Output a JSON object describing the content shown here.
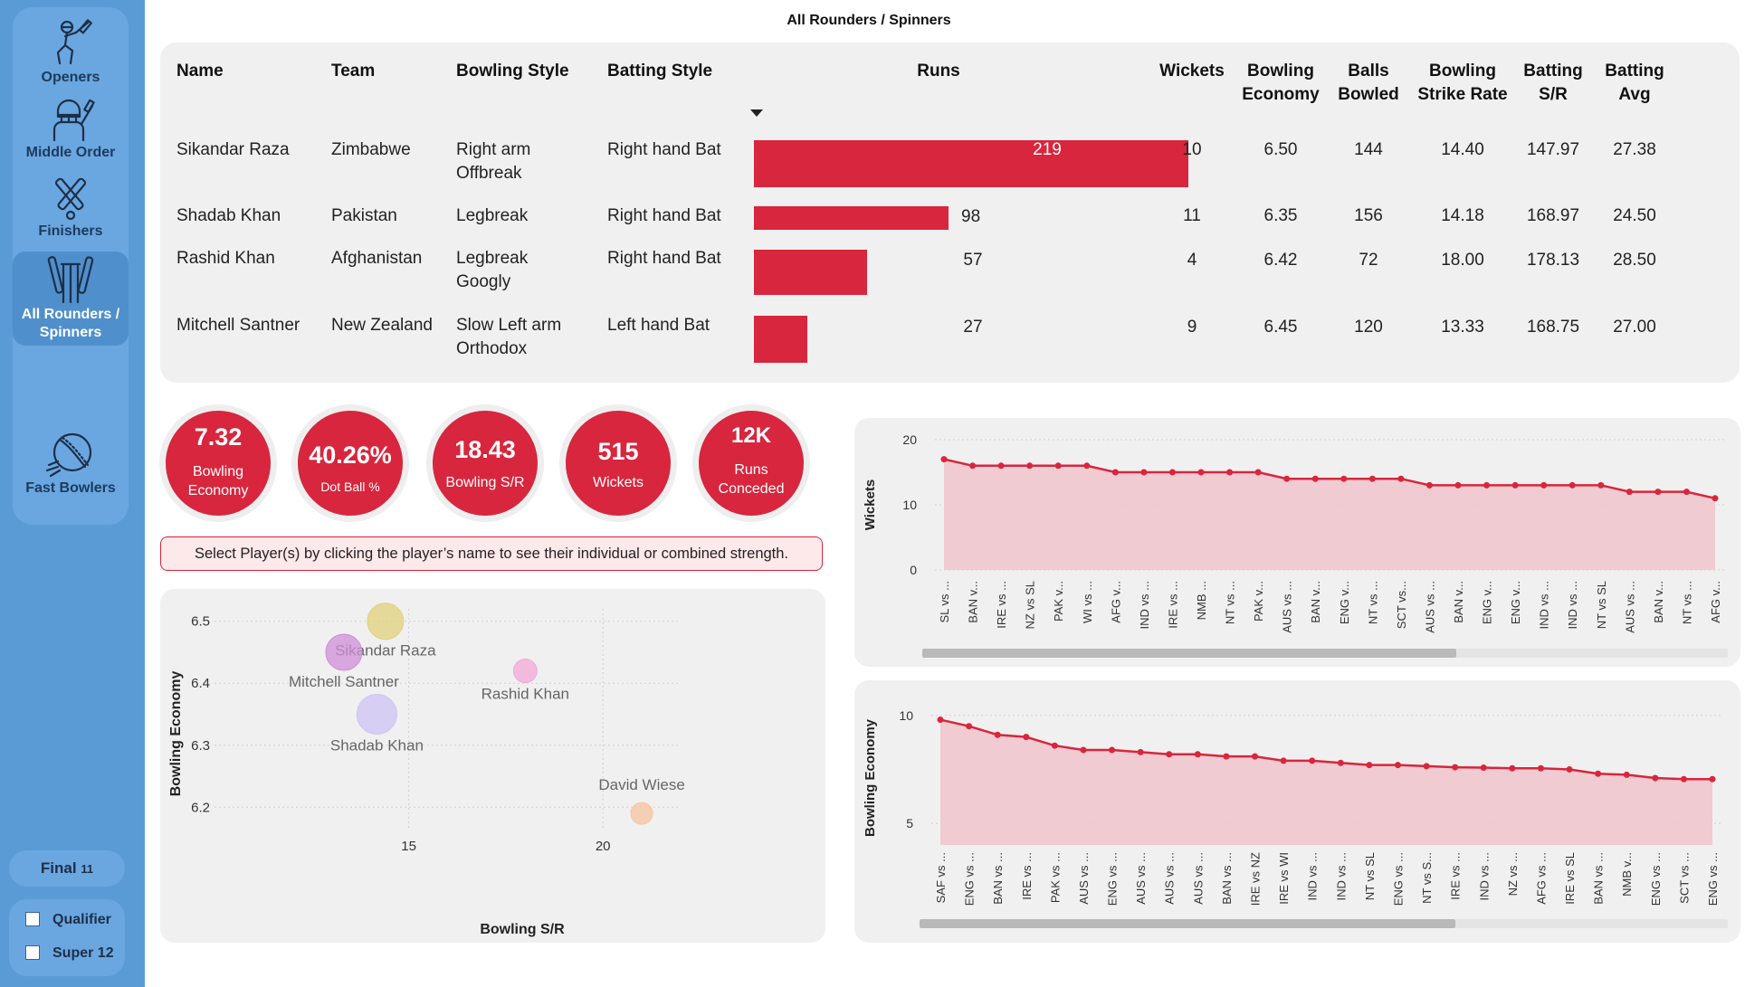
{
  "sidebar": {
    "items": [
      {
        "label": "Openers",
        "icon": "batsman-icon"
      },
      {
        "label": "Middle Order",
        "icon": "batsman-helmet-icon"
      },
      {
        "label": "Finishers",
        "icon": "crossed-bats-icon"
      },
      {
        "label": "All Rounders / Spinners",
        "icon": "stumps-bats-icon"
      },
      {
        "label": "Fast Bowlers",
        "icon": "cricket-ball-icon"
      }
    ],
    "final": {
      "label": "Final",
      "count": "11"
    },
    "filters": [
      {
        "label": "Qualifier",
        "checked": false
      },
      {
        "label": "Super 12",
        "checked": false
      }
    ]
  },
  "page": {
    "title": "All Rounders / Spinners"
  },
  "table": {
    "headers": {
      "name": "Name",
      "team": "Team",
      "bowling_style": "Bowling Style",
      "batting_style": "Batting Style",
      "runs": "Runs",
      "wickets": "Wickets",
      "economy": [
        "Bowling",
        "Economy"
      ],
      "balls": [
        "Balls",
        "Bowled"
      ],
      "strike": [
        "Bowling",
        "Strike Rate"
      ],
      "bat_sr": [
        "Batting",
        "S/R"
      ],
      "bat_avg": [
        "Batting",
        "Avg"
      ]
    },
    "runs_max": 219,
    "rows": [
      {
        "name": "Sikandar Raza",
        "team": "Zimbabwe",
        "bowling_style": [
          "Right arm",
          "Offbreak"
        ],
        "batting_style": "Right hand Bat",
        "runs": 219,
        "wickets": "10",
        "economy": "6.50",
        "balls": "144",
        "strike": "14.40",
        "bat_sr": "147.97",
        "bat_avg": "27.38"
      },
      {
        "name": "Shadab Khan",
        "team": "Pakistan",
        "bowling_style": [
          "Legbreak",
          ""
        ],
        "batting_style": "Right hand Bat",
        "runs": 98,
        "wickets": "11",
        "economy": "6.35",
        "balls": "156",
        "strike": "14.18",
        "bat_sr": "168.97",
        "bat_avg": "24.50"
      },
      {
        "name": "Rashid Khan",
        "team": "Afghanistan",
        "bowling_style": [
          "Legbreak",
          "Googly"
        ],
        "batting_style": "Right hand Bat",
        "runs": 57,
        "wickets": "4",
        "economy": "6.42",
        "balls": "72",
        "strike": "18.00",
        "bat_sr": "178.13",
        "bat_avg": "28.50"
      },
      {
        "name": "Mitchell Santner",
        "team": "New Zealand",
        "bowling_style": [
          "Slow Left arm",
          "Orthodox"
        ],
        "batting_style": "Left hand Bat",
        "runs": 27,
        "wickets": "9",
        "economy": "6.45",
        "balls": "120",
        "strike": "13.33",
        "bat_sr": "168.75",
        "bat_avg": "27.00"
      }
    ]
  },
  "kpis": [
    {
      "value": "7.32",
      "label": [
        "Bowling",
        "Economy"
      ]
    },
    {
      "value": "40.26%",
      "label": [
        "Dot Ball %"
      ]
    },
    {
      "value": "18.43",
      "label": [
        "Bowling S/R"
      ]
    },
    {
      "value": "515",
      "label": [
        "Wickets"
      ]
    },
    {
      "value": "12K",
      "label": [
        "Runs",
        "Conceded"
      ]
    }
  ],
  "banner": "Select Player(s) by clicking the player’s name to see their individual or combined strength.",
  "colors": {
    "accent": "#d7263d",
    "area": "#efc7cd",
    "sidebar": "#5b9bd5"
  },
  "chart_data": [
    {
      "type": "scatter",
      "xlabel": "Bowling S/R",
      "ylabel": "Bowling Economy",
      "xlim": [
        10,
        22
      ],
      "ylim": [
        6.18,
        6.52
      ],
      "xticks": [
        15,
        20
      ],
      "yticks": [
        6.2,
        6.3,
        6.4,
        6.5
      ],
      "grid": true,
      "points": [
        {
          "label": "Sikandar Raza",
          "x": 14.4,
          "y": 6.5,
          "color": "#e0d27c"
        },
        {
          "label": "Mitchell Santner",
          "x": 13.33,
          "y": 6.45,
          "color": "#cf8fd8"
        },
        {
          "label": "Rashid Khan",
          "x": 18.0,
          "y": 6.42,
          "color": "#f3a9d8"
        },
        {
          "label": "Shadab Khan",
          "x": 14.18,
          "y": 6.35,
          "color": "#cfc3f5"
        },
        {
          "label": "David Wiese",
          "x": 21.0,
          "y": 6.19,
          "color": "#f7c4a0"
        }
      ]
    },
    {
      "type": "area",
      "ylabel": "Wickets",
      "ylim": [
        0,
        20
      ],
      "yticks": [
        0,
        10,
        20
      ],
      "grid": true,
      "categories": [
        "SL vs ...",
        "BAN v...",
        "IRE vs ...",
        "NZ vs SL",
        "PAK v...",
        "WI vs ...",
        "AFG v...",
        "IND vs ...",
        "IRE vs ...",
        "NMB ...",
        "NT vs ...",
        "PAK v...",
        "AUS vs ...",
        "BAN v...",
        "ENG v...",
        "NT vs ...",
        "SCT vs...",
        "AUS vs ...",
        "BAN v...",
        "ENG v...",
        "ENG v...",
        "IND vs ...",
        "IND vs ...",
        "NT vs SL",
        "AUS vs ...",
        "BAN v...",
        "NT vs ...",
        "AFG v..."
      ],
      "values": [
        17,
        16,
        16,
        16,
        16,
        16,
        15,
        15,
        15,
        15,
        15,
        15,
        14,
        14,
        14,
        14,
        14,
        13,
        13,
        13,
        13,
        13,
        13,
        13,
        12,
        12,
        12,
        11
      ]
    },
    {
      "type": "area",
      "ylabel": "Bowling Economy",
      "ylim": [
        4,
        10.2
      ],
      "yticks": [
        5,
        10
      ],
      "grid": true,
      "categories": [
        "SAF vs ...",
        "ENG vs ...",
        "BAN vs ...",
        "IRE vs ...",
        "PAK vs ...",
        "AUS vs ...",
        "ENG vs ...",
        "AUS vs ...",
        "AUS vs ...",
        "AUS vs ...",
        "BAN vs ...",
        "IRE vs NZ",
        "IRE vs WI",
        "IND vs ...",
        "IND vs ...",
        "NT vs SL",
        "ENG vs ...",
        "NT vs S...",
        "IRE vs ...",
        "IND vs ...",
        "NZ vs ...",
        "AFG vs ...",
        "IRE vs SL",
        "BAN vs ...",
        "NMB v...",
        "ENG vs ...",
        "SCT vs ...",
        "ENG vs ..."
      ],
      "values": [
        9.8,
        9.5,
        9.1,
        9.0,
        8.6,
        8.4,
        8.4,
        8.3,
        8.2,
        8.2,
        8.1,
        8.1,
        7.9,
        7.9,
        7.8,
        7.7,
        7.7,
        7.65,
        7.6,
        7.58,
        7.55,
        7.55,
        7.5,
        7.3,
        7.25,
        7.1,
        7.05,
        7.05
      ]
    }
  ]
}
